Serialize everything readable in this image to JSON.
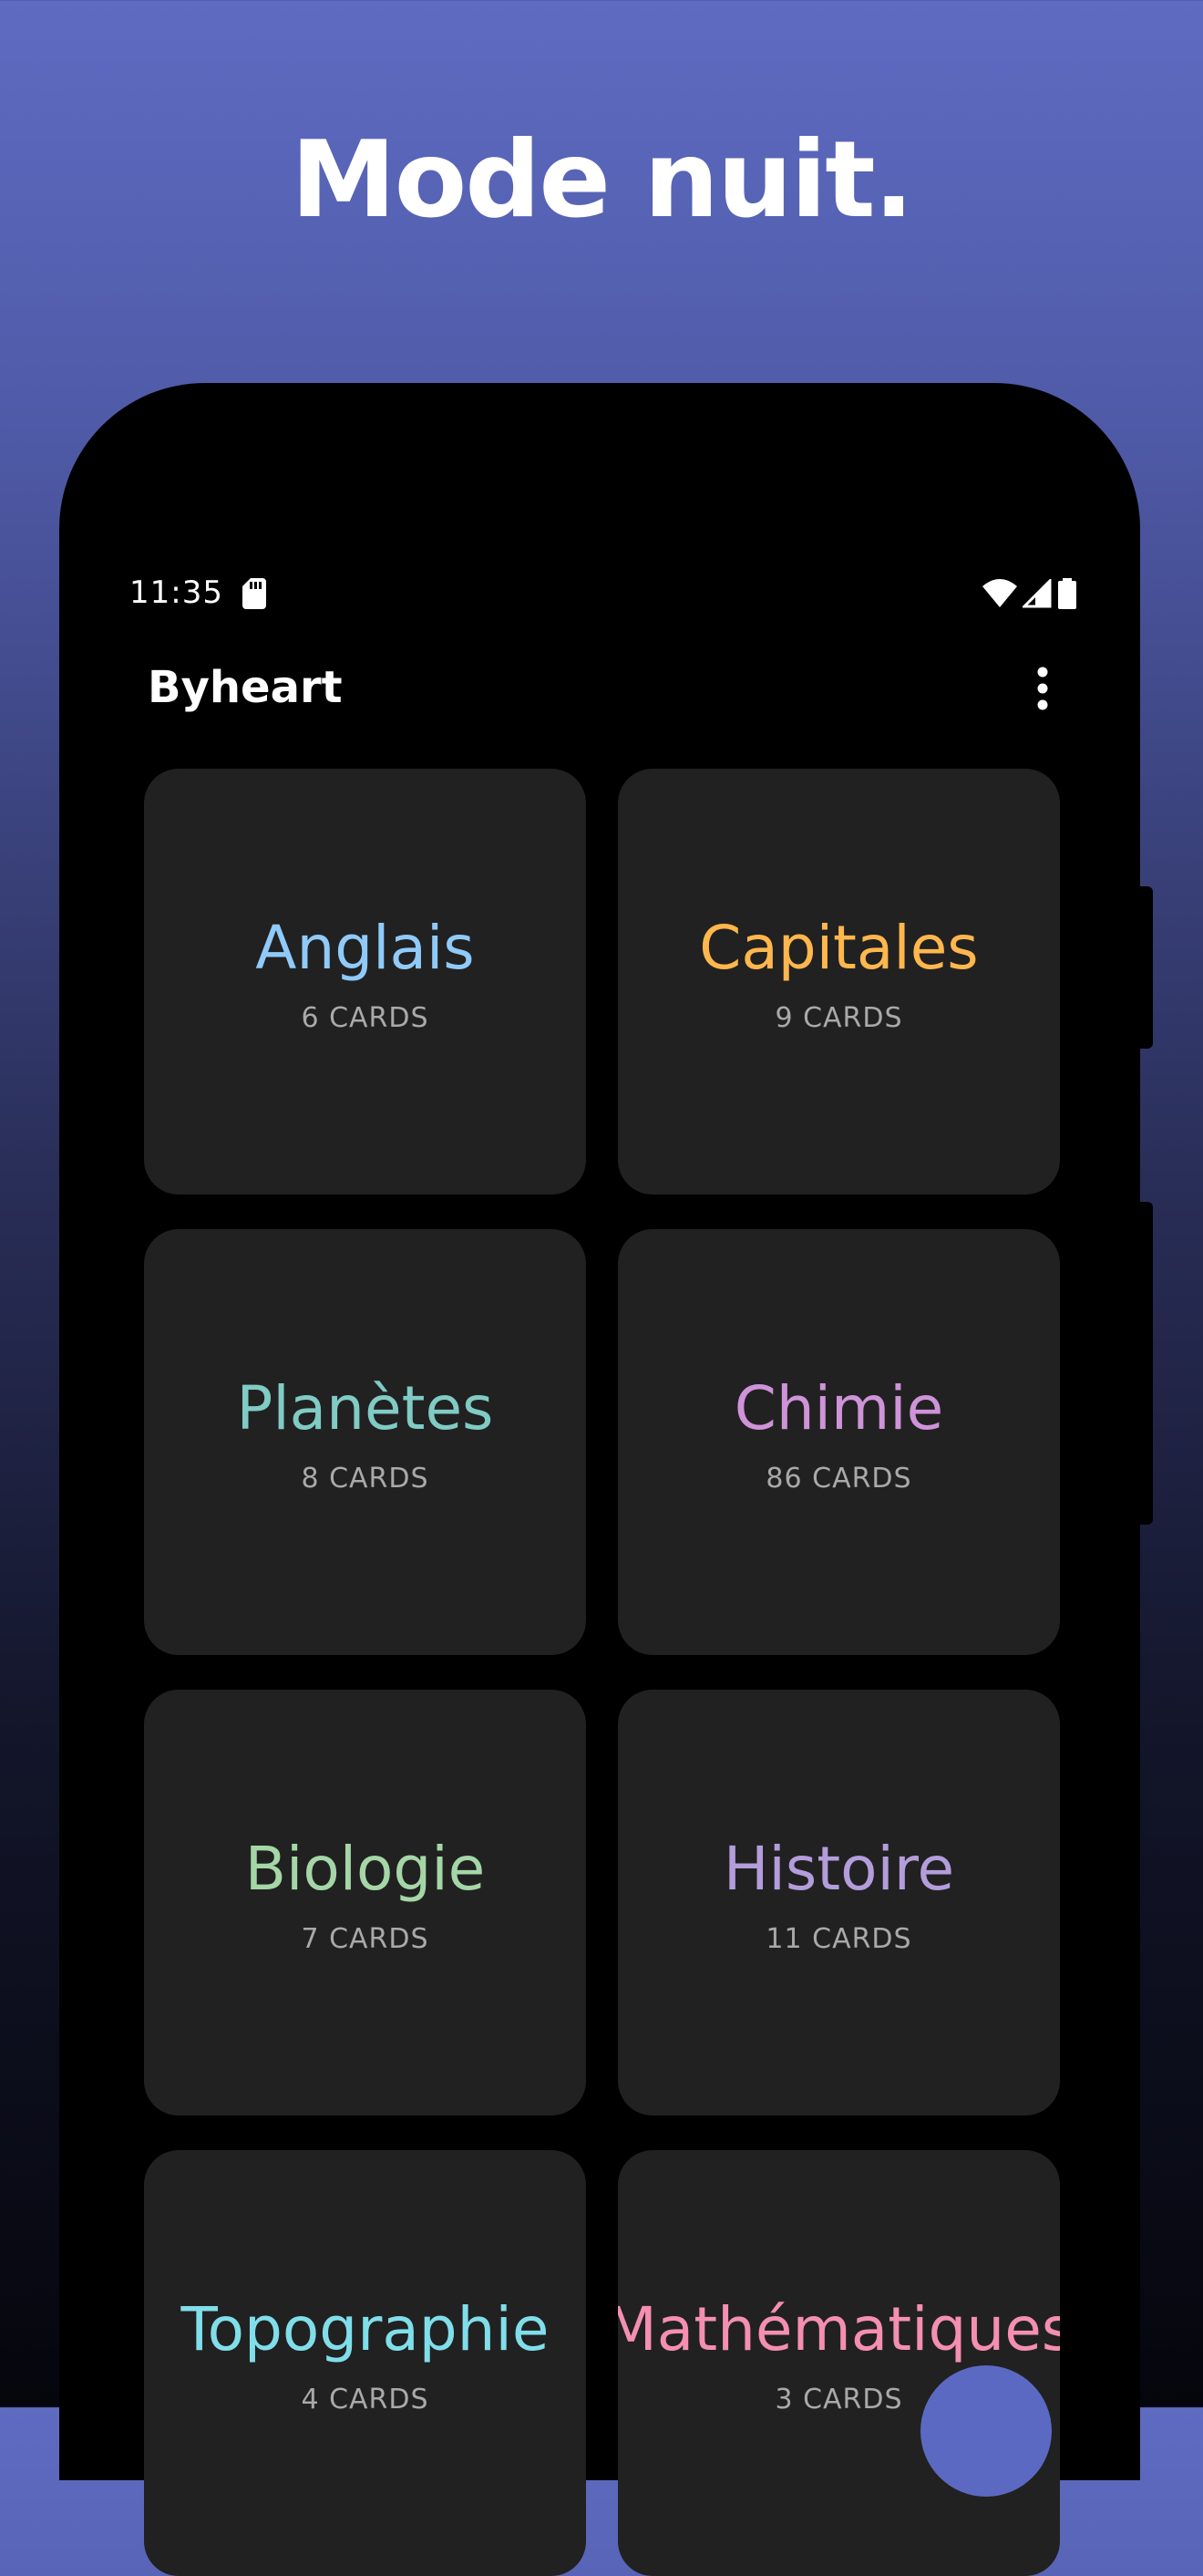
{
  "promo": {
    "headline": "Mode nuit."
  },
  "status_bar": {
    "time": "11:35",
    "icons": [
      "sd-card-icon",
      "wifi-icon",
      "cellular-signal-icon",
      "battery-icon"
    ]
  },
  "app_bar": {
    "title": "Byheart",
    "menu_icon": "more-vert-icon"
  },
  "decks": [
    {
      "name": "Anglais",
      "count": "6 CARDS",
      "color": "#90caf9"
    },
    {
      "name": "Capitales",
      "count": "9 CARDS",
      "color": "#ffb74d"
    },
    {
      "name": "Planètes",
      "count": "8 CARDS",
      "color": "#80cbc4"
    },
    {
      "name": "Chimie",
      "count": "86 CARDS",
      "color": "#ce93d8"
    },
    {
      "name": "Biologie",
      "count": "7 CARDS",
      "color": "#a5d6a7"
    },
    {
      "name": "Histoire",
      "count": "11 CARDS",
      "color": "#b39ddb"
    },
    {
      "name": "Topographie",
      "count": "4 CARDS",
      "color": "#80deea"
    },
    {
      "name": "Mathématiques",
      "count": "3 CARDS",
      "color": "#f48fb1"
    }
  ],
  "fab": {
    "icon": "add-icon",
    "color": "#5b69c2"
  },
  "colors": {
    "background_top": "#5e6bc1",
    "background_bottom": "#05060c",
    "card_background": "#212121",
    "count_text": "#a9a9a9"
  }
}
